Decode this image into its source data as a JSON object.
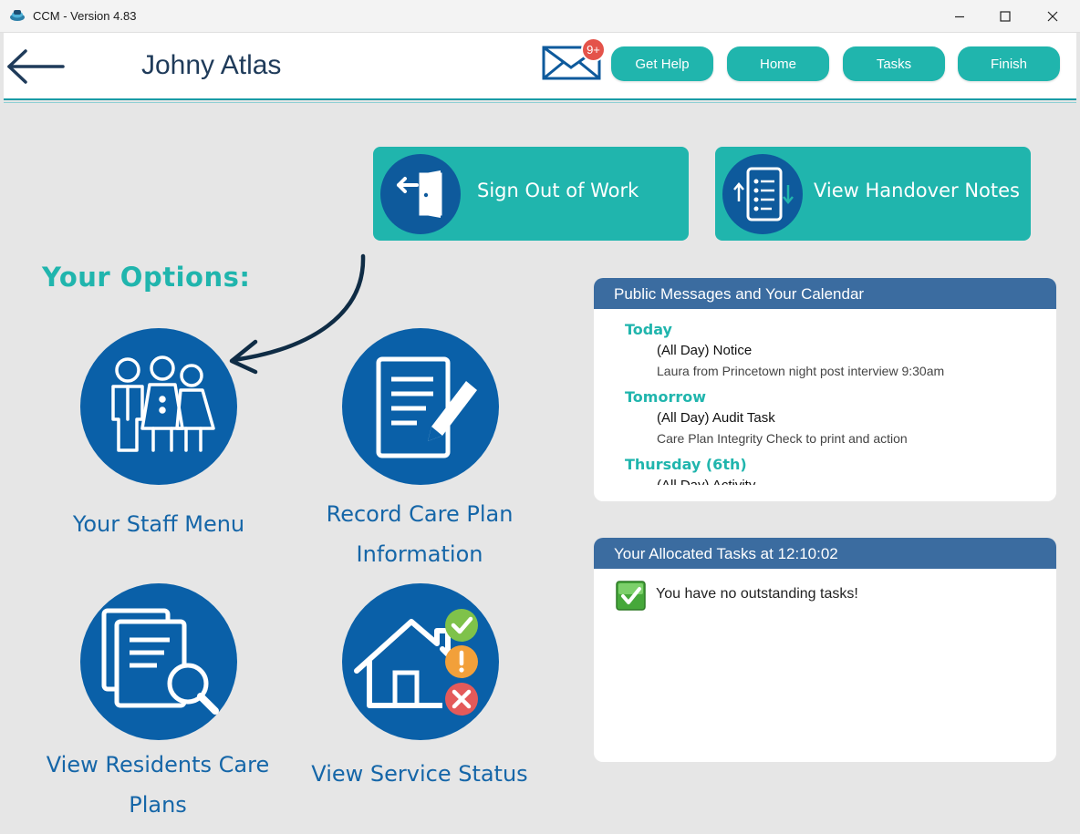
{
  "window": {
    "title": "CCM - Version 4.83",
    "minimize": "—",
    "maximize": "☐",
    "close": "✕"
  },
  "header": {
    "user_name": "Johny Atlas",
    "mail_badge": "9+",
    "buttons": {
      "get_help": "Get Help",
      "home": "Home",
      "tasks": "Tasks",
      "finish": "Finish"
    }
  },
  "actions": {
    "sign_out": "Sign Out of Work",
    "handover": "View Handover Notes"
  },
  "options": {
    "title": "Your Options:",
    "staff_menu_line1": "Your Staff Menu",
    "record_line1": "Record Care Plan",
    "record_line2": "Information",
    "view_plans_line1": "View Residents Care",
    "view_plans_line2": "Plans",
    "service_status_line1": "View Service Status"
  },
  "calendar": {
    "title": "Public Messages and Your Calendar",
    "days": [
      {
        "label": "Today",
        "event_title": "(All Day) Notice",
        "event_desc": "Laura from Princetown night post interview 9:30am"
      },
      {
        "label": "Tomorrow",
        "event_title": "(All Day) Audit Task",
        "event_desc": "Care Plan Integrity Check to print and action"
      },
      {
        "label": "Thursday (6th)",
        "event_title": "(All Day) Activity",
        "event_desc": ""
      }
    ]
  },
  "tasks": {
    "title": "Your Allocated Tasks at 12:10:02",
    "message": "You have no outstanding tasks!"
  },
  "colors": {
    "teal": "#20b5ad",
    "navy": "#0a60a8",
    "panel_header": "#3b6ca0",
    "badge": "#e4534a"
  }
}
